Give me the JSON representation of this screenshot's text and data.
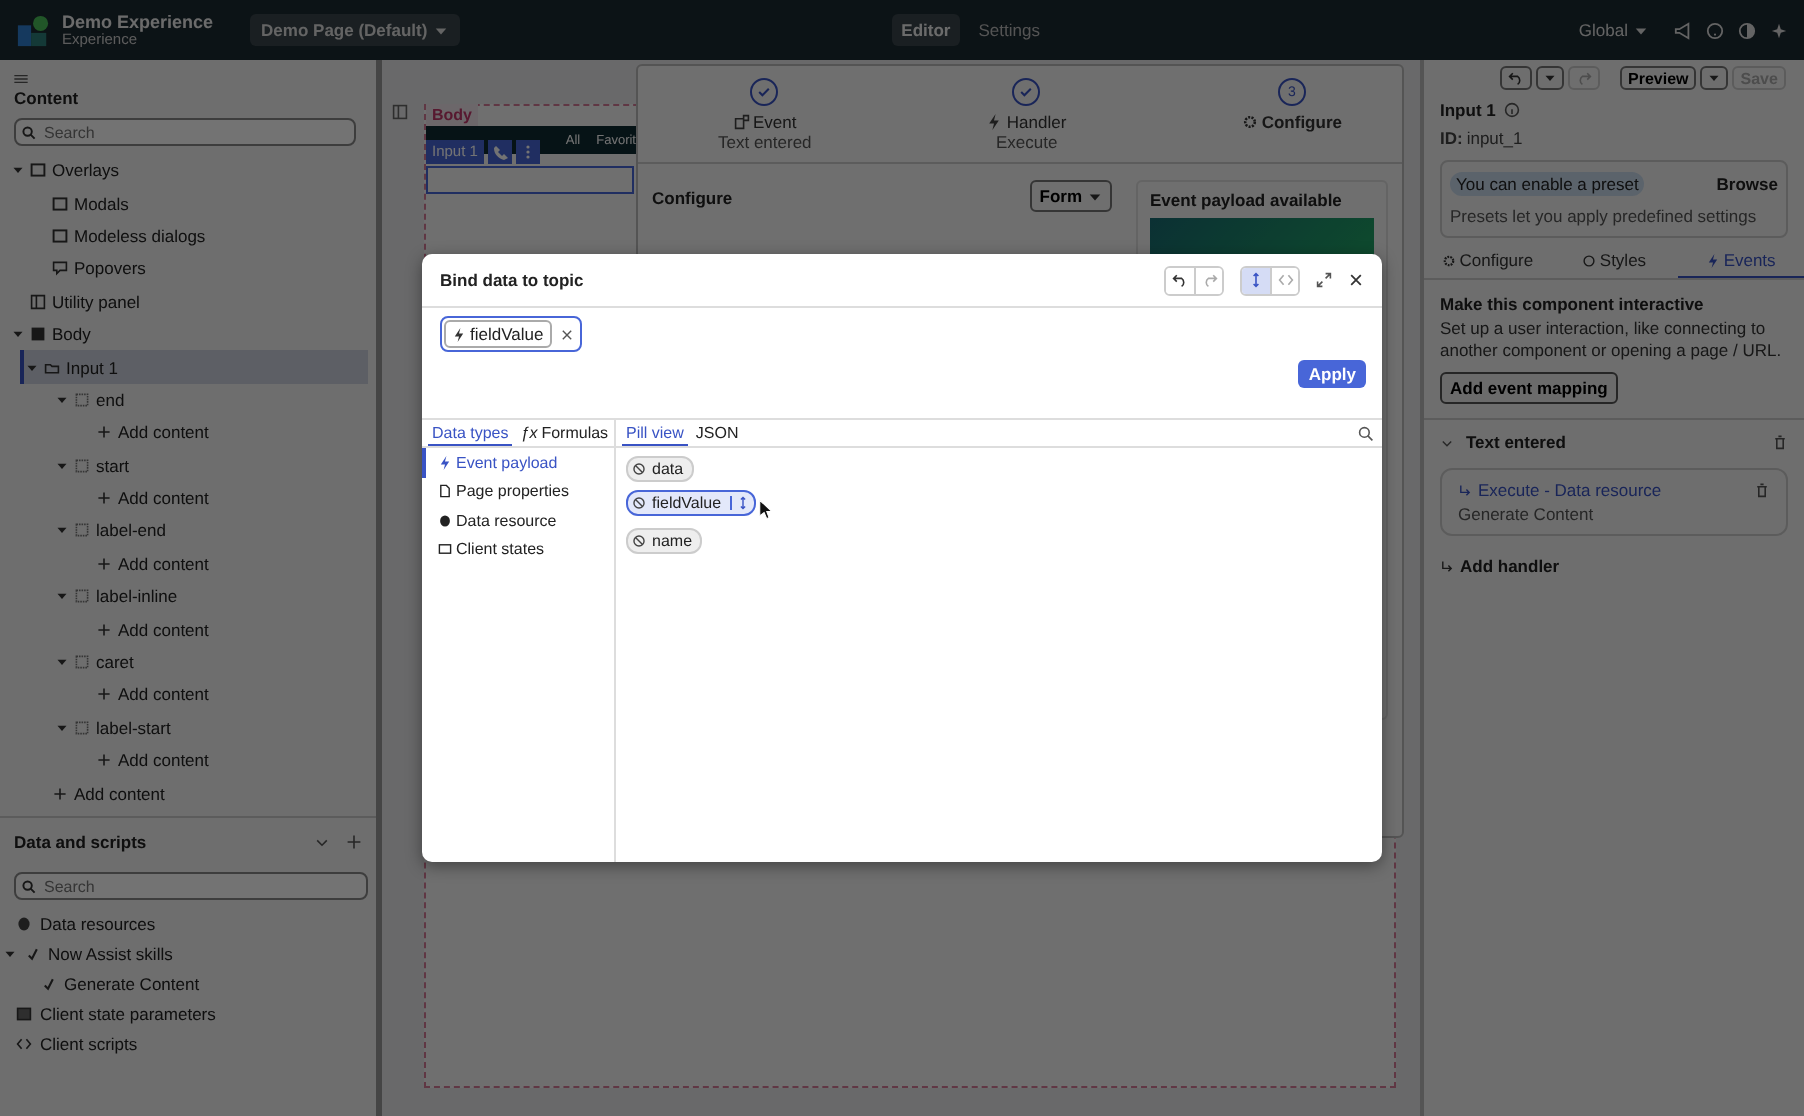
{
  "app_header": {
    "title": "Demo Experience",
    "subtitle": "Experience",
    "page_selector": "Demo Page (Default)",
    "tabs": [
      {
        "label": "Editor",
        "selected": true
      },
      {
        "label": "Settings",
        "selected": false
      }
    ],
    "scope": "Global"
  },
  "toolbar": {
    "preview": "Preview",
    "save": "Save",
    "save_disabled": true
  },
  "content_panel": {
    "title": "Content",
    "search_placeholder": "Search",
    "tree": [
      {
        "label": "Overlays",
        "kind": "overlay",
        "expanded": true,
        "selected": false,
        "children": [
          {
            "label": "Modals",
            "kind": "modal",
            "selected": false
          },
          {
            "label": "Modeless dialogs",
            "kind": "modeless",
            "selected": false
          },
          {
            "label": "Popovers",
            "kind": "popover",
            "selected": false
          }
        ]
      },
      {
        "label": "Utility panel",
        "kind": "panel",
        "selected": false
      },
      {
        "label": "Body",
        "kind": "body",
        "expanded": true,
        "selected": false,
        "children": [
          {
            "label": "Input 1",
            "kind": "input",
            "expanded": true,
            "selected": true,
            "children": [
              {
                "label": "end",
                "kind": "slot",
                "expanded": true,
                "selected": false,
                "children": [
                  {
                    "label": "Add content",
                    "kind": "add",
                    "selected": false
                  }
                ]
              },
              {
                "label": "start",
                "kind": "slot",
                "expanded": true,
                "selected": false,
                "children": [
                  {
                    "label": "Add content",
                    "kind": "add",
                    "selected": false
                  }
                ]
              },
              {
                "label": "label-end",
                "kind": "slot",
                "expanded": true,
                "selected": false,
                "children": [
                  {
                    "label": "Add content",
                    "kind": "add",
                    "selected": false
                  }
                ]
              },
              {
                "label": "label-inline",
                "kind": "slot",
                "expanded": true,
                "selected": false,
                "children": [
                  {
                    "label": "Add content",
                    "kind": "add",
                    "selected": false
                  }
                ]
              },
              {
                "label": "caret",
                "kind": "slot",
                "expanded": true,
                "selected": false,
                "children": [
                  {
                    "label": "Add content",
                    "kind": "add",
                    "selected": false
                  }
                ]
              },
              {
                "label": "label-start",
                "kind": "slot",
                "expanded": true,
                "selected": false,
                "children": [
                  {
                    "label": "Add content",
                    "kind": "add",
                    "selected": false
                  }
                ]
              }
            ]
          },
          {
            "label": "Add content",
            "kind": "add",
            "selected": false
          }
        ]
      }
    ]
  },
  "data_panel": {
    "title": "Data and scripts",
    "search_placeholder": "Search",
    "tree": [
      {
        "label": "Data resources",
        "kind": "database"
      },
      {
        "label": "Now Assist skills",
        "kind": "skill",
        "expanded": true,
        "children": [
          {
            "label": "Generate Content",
            "kind": "skill"
          }
        ]
      },
      {
        "label": "Client state parameters",
        "kind": "state"
      },
      {
        "label": "Client scripts",
        "kind": "script"
      }
    ]
  },
  "canvas": {
    "body_tag": "Body",
    "selected_tag": "Input 1",
    "nav_items": [
      "All",
      "Favorit"
    ]
  },
  "event_wizard": {
    "steps": [
      {
        "label": "Event",
        "detail": "Text entered",
        "kind": "event",
        "done": true
      },
      {
        "label": "Handler",
        "detail": "Execute",
        "kind": "handler",
        "done": true
      },
      {
        "label": "Configure",
        "number": "3",
        "kind": "configure",
        "done": false
      }
    ],
    "section": "Configure",
    "mode": "Form",
    "payload_title": "Event payload available"
  },
  "properties": {
    "title": "Input 1",
    "id_label": "ID:",
    "id": "input_1",
    "preset_hint": "You can enable a preset",
    "browse": "Browse",
    "preset_description": "Presets let you apply predefined settings",
    "tabs": [
      {
        "label": "Configure",
        "kind": "gear",
        "selected": false
      },
      {
        "label": "Styles",
        "kind": "palette",
        "selected": false
      },
      {
        "label": "Events",
        "kind": "bolt",
        "selected": true
      }
    ],
    "heading": "Make this component interactive",
    "description": "Set up a user interaction, like connecting to another component or opening a page / URL.",
    "add_mapping": "Add event mapping",
    "event": {
      "name": "Text entered",
      "expanded": true,
      "handler_title": "Execute - Data resource",
      "handler_detail": "Generate Content"
    },
    "add_handler": "Add handler"
  },
  "modal": {
    "title": "Bind data to topic",
    "chip": "fieldValue",
    "apply": "Apply",
    "source_tabs": [
      {
        "label": "Data types",
        "selected": true
      },
      {
        "label": "Formulas",
        "icon_text": "ƒx",
        "selected": false
      }
    ],
    "sources": [
      {
        "label": "Event payload",
        "kind": "payload",
        "selected": true
      },
      {
        "label": "Page properties",
        "kind": "page",
        "selected": false
      },
      {
        "label": "Data resource",
        "kind": "database",
        "selected": false
      },
      {
        "label": "Client states",
        "kind": "state",
        "selected": false
      }
    ],
    "view_tabs": [
      {
        "label": "Pill view",
        "selected": true
      },
      {
        "label": "JSON",
        "selected": false
      }
    ],
    "pills": [
      {
        "label": "data",
        "selected": false
      },
      {
        "label": "fieldValue",
        "selected": true
      },
      {
        "label": "name",
        "selected": false
      }
    ]
  }
}
